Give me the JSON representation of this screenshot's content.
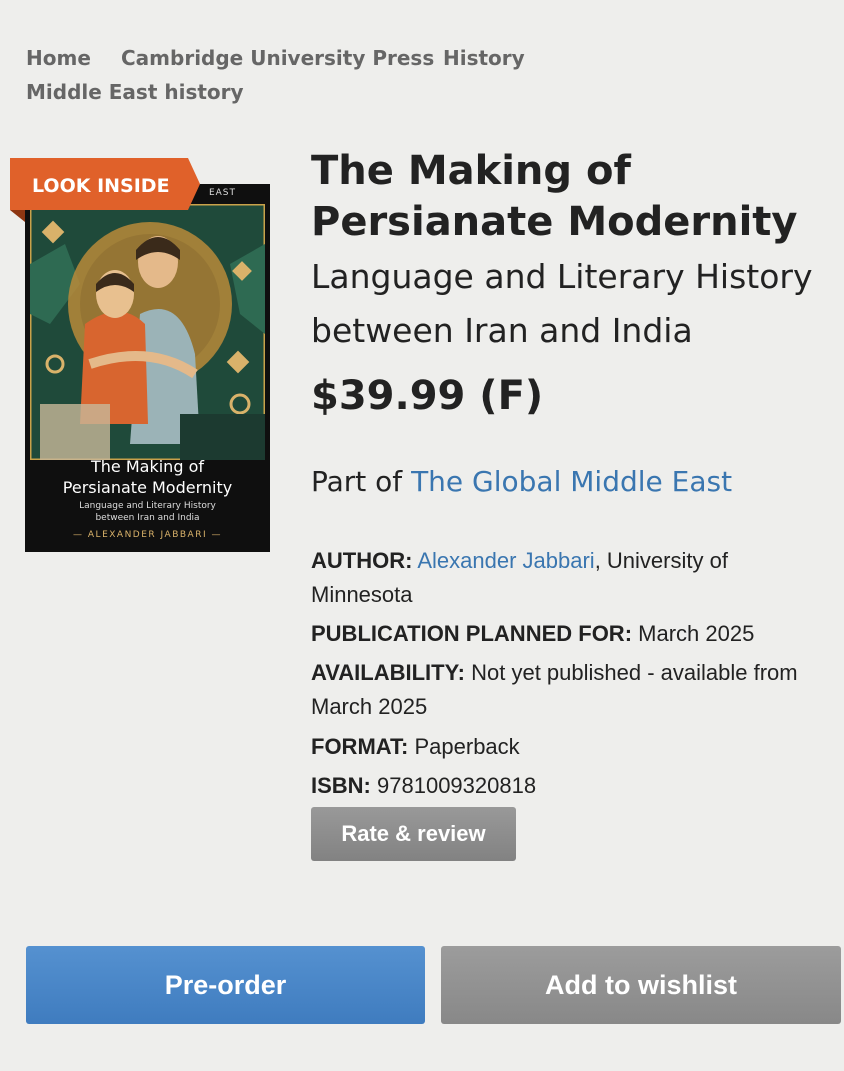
{
  "breadcrumbs": [
    "Home",
    "Cambridge University Press",
    "History",
    "Middle East history"
  ],
  "look_inside": "LOOK INSIDE",
  "cover": {
    "series": "EAST",
    "title_line1": "The Making of",
    "title_line2": "Persianate Modernity",
    "sub_line1": "Language and Literary History",
    "sub_line2": "between Iran and India",
    "author": "— ALEXANDER JABBARI —"
  },
  "book": {
    "title_line1": "The Making of",
    "title_line2": "Persianate Modernity",
    "subtitle_line1": "Language and Literary History",
    "subtitle_line2": "between Iran and India",
    "price": "$39.99 (F)",
    "series_prefix": "Part of ",
    "series_link": "The Global Middle East"
  },
  "details": {
    "author_label": "AUTHOR:",
    "author_name": "Alexander Jabbari",
    "author_affil_1": ", University of",
    "author_affil_2": "Minnesota",
    "pub_label": "PUBLICATION PLANNED FOR:",
    "pub_value": "March 2025",
    "avail_label": "AVAILABILITY:",
    "avail_value_1": "Not yet published - available from",
    "avail_value_2": "March 2025",
    "format_label": "FORMAT:",
    "format_value": "Paperback",
    "isbn_label": "ISBN:",
    "isbn_value": "9781009320818"
  },
  "buttons": {
    "rate": "Rate & review",
    "preorder": "Pre-order",
    "wishlist": "Add to wishlist"
  },
  "colors": {
    "link": "#3a76b0",
    "look_inside_ribbon": "#e0612a",
    "preorder": "#4a86c8",
    "wishlist": "#929292"
  }
}
